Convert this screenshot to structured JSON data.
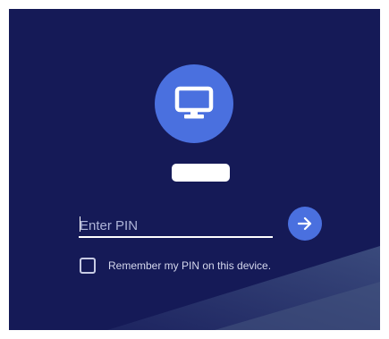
{
  "user": {
    "avatar_icon": "monitor-icon",
    "name_redacted": true
  },
  "pin": {
    "placeholder": "Enter PIN",
    "value": "",
    "submit_icon": "arrow-right-icon"
  },
  "remember": {
    "label": "Remember my PIN on this device.",
    "checked": false
  },
  "colors": {
    "background": "#151a57",
    "accent": "#4a70df",
    "text": "#ffffff"
  }
}
